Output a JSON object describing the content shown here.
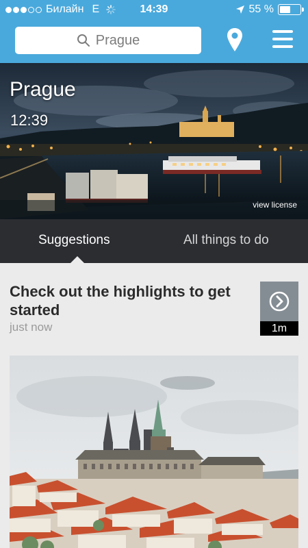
{
  "status_bar": {
    "carrier": "Билайн",
    "network": "E",
    "time": "14:39",
    "battery": "55 %",
    "battery_level": 0.55
  },
  "nav": {
    "search_value": "Prague"
  },
  "hero": {
    "city": "Prague",
    "time": "12:39",
    "license_link": "view license"
  },
  "tabs": [
    {
      "label": "Suggestions"
    },
    {
      "label": "All things to do"
    }
  ],
  "card": {
    "title": "Check out the highlights to get started",
    "timestamp": "just now",
    "video_duration": "1m"
  },
  "colors": {
    "brand_blue": "#4aa9dc",
    "tab_bar": "#2b2d31",
    "background": "#ebebeb"
  }
}
